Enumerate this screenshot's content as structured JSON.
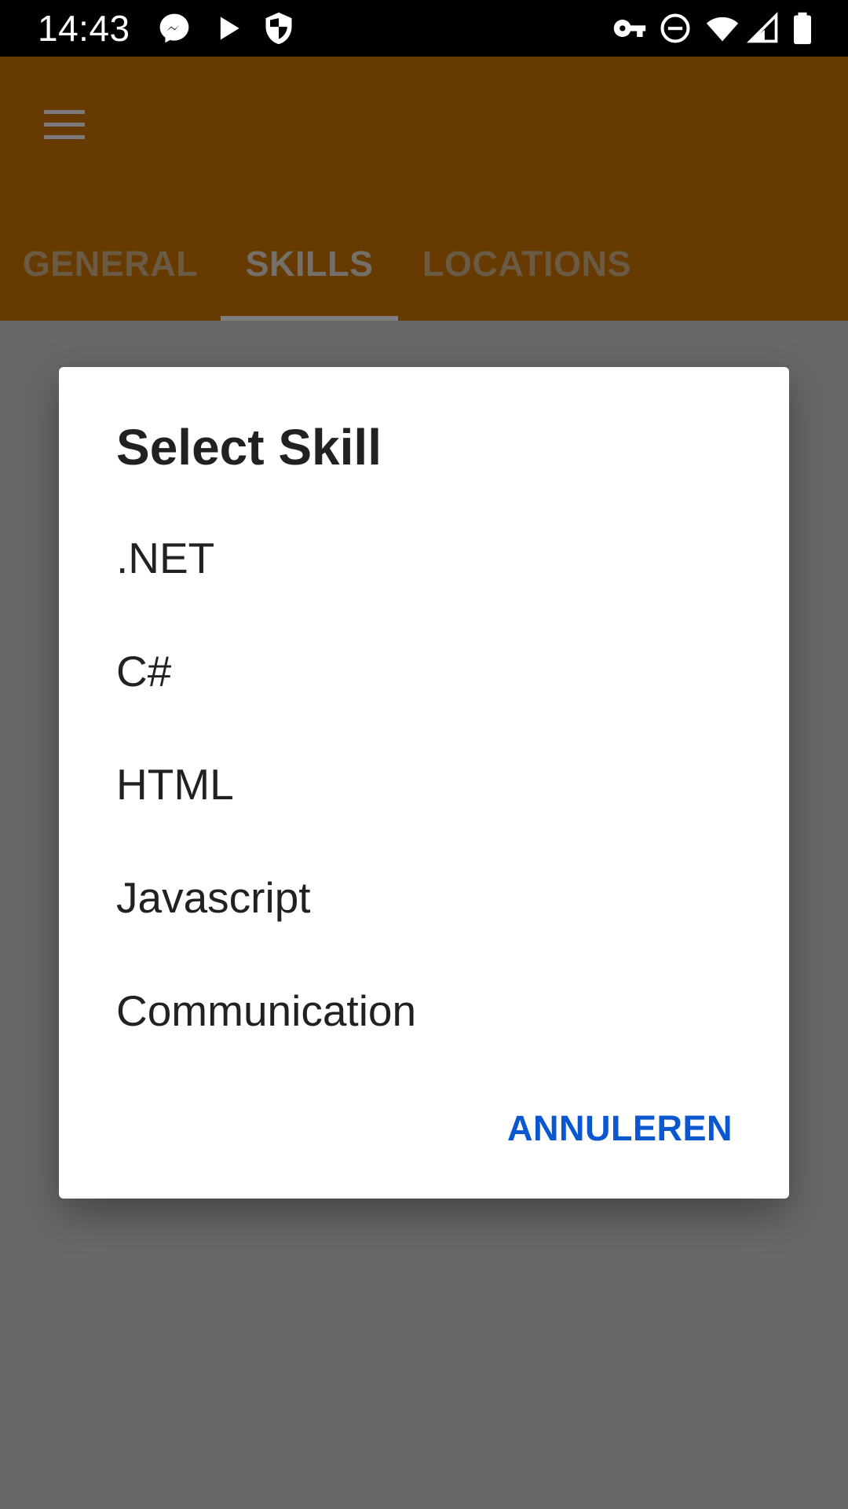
{
  "status_bar": {
    "time": "14:43",
    "left_icons": [
      "messenger-icon",
      "play-icon",
      "shield-icon"
    ],
    "right_icons": [
      "vpn-key-icon",
      "do-not-disturb-icon",
      "wifi-icon",
      "signal-icon",
      "battery-icon"
    ]
  },
  "app_bar": {
    "menu_icon": "hamburger-menu-icon",
    "tabs": [
      {
        "label": "GENERAL",
        "active": false
      },
      {
        "label": "SKILLS",
        "active": true
      },
      {
        "label": "LOCATIONS",
        "active": false
      }
    ]
  },
  "dialog": {
    "title": "Select Skill",
    "items": [
      ".NET",
      "C#",
      "HTML",
      "Javascript",
      "Communication"
    ],
    "cancel_label": "ANNULEREN"
  },
  "colors": {
    "app_bar_dimmed": "#663a00",
    "scrim_background": "#686868",
    "accent_button": "#0b57d0"
  }
}
